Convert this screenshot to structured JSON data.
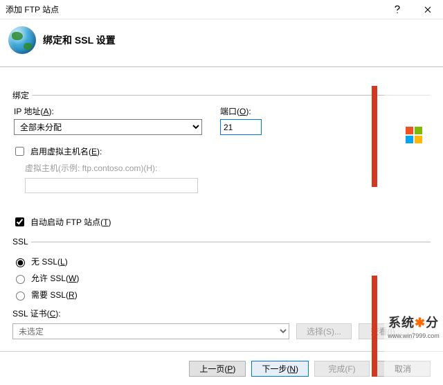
{
  "window": {
    "title": "添加 FTP 站点"
  },
  "header": {
    "title": "绑定和 SSL 设置"
  },
  "binding": {
    "legend": "绑定",
    "ip_label_pre": "IP 地址(",
    "ip_label_key": "A",
    "ip_label_post": "):",
    "ip_value": "全部未分配",
    "port_label_pre": "端口(",
    "port_label_key": "O",
    "port_label_post": "):",
    "port_value": "21",
    "vhost_enable_pre": "启用虚拟主机名(",
    "vhost_enable_key": "E",
    "vhost_enable_post": "):",
    "vhost_enable_checked": false,
    "vhost_label_pre": "虚拟主机(示例: ftp.contoso.com)(",
    "vhost_label_key": "H",
    "vhost_label_post": "):",
    "vhost_value": ""
  },
  "autostart": {
    "label_pre": "自动启动 FTP 站点(",
    "label_key": "T",
    "label_post": ")",
    "checked": true
  },
  "ssl": {
    "legend": "SSL",
    "none_pre": "无 SSL(",
    "none_key": "L",
    "none_post": ")",
    "allow_pre": "允许 SSL(",
    "allow_key": "W",
    "allow_post": ")",
    "require_pre": "需要 SSL(",
    "require_key": "R",
    "require_post": ")",
    "selected": "none",
    "cert_label_pre": "SSL 证书(",
    "cert_label_key": "C",
    "cert_label_post": "):",
    "cert_value": "未选定",
    "select_btn_pre": "选择(",
    "select_btn_key": "S",
    "select_btn_post": ")...",
    "view_btn_pre": "查看(",
    "view_btn_key": "I",
    "view_btn_post": ")..."
  },
  "footer": {
    "prev_pre": "上一页(",
    "prev_key": "P",
    "prev_post": ")",
    "next_pre": "下一步(",
    "next_key": "N",
    "next_post": ")",
    "finish_pre": "完成(",
    "finish_key": "F",
    "finish_post": ")",
    "cancel": "取消"
  },
  "watermark": {
    "text_cn": "系统",
    "text_star": "✱",
    "text_cn2": "分",
    "url": "www.win7999.com"
  }
}
